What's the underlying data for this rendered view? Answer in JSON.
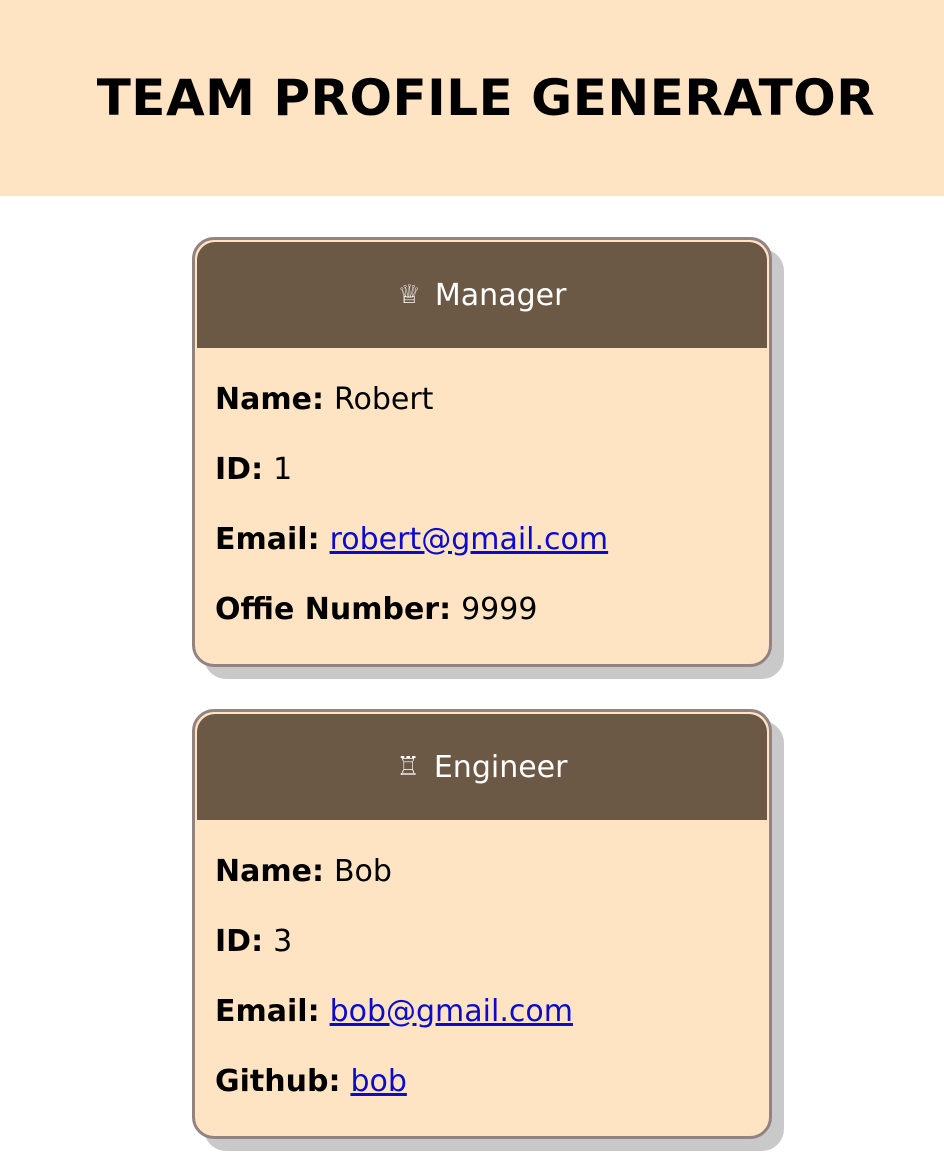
{
  "header": {
    "title": "TEAM PROFILE GENERATOR"
  },
  "cards": [
    {
      "role": "Manager",
      "icon": "♕",
      "name_label": "Name:",
      "name": "Robert",
      "id_label": "ID:",
      "id": "1",
      "email_label": "Email:",
      "email": "robert@gmail.com",
      "extra_label": "Offie Number:",
      "extra": "9999"
    },
    {
      "role": "Engineer",
      "icon": "♖",
      "name_label": "Name:",
      "name": "Bob",
      "id_label": "ID:",
      "id": "3",
      "email_label": "Email:",
      "email": "bob@gmail.com",
      "extra_label": "Github:",
      "extra": "bob"
    }
  ]
}
